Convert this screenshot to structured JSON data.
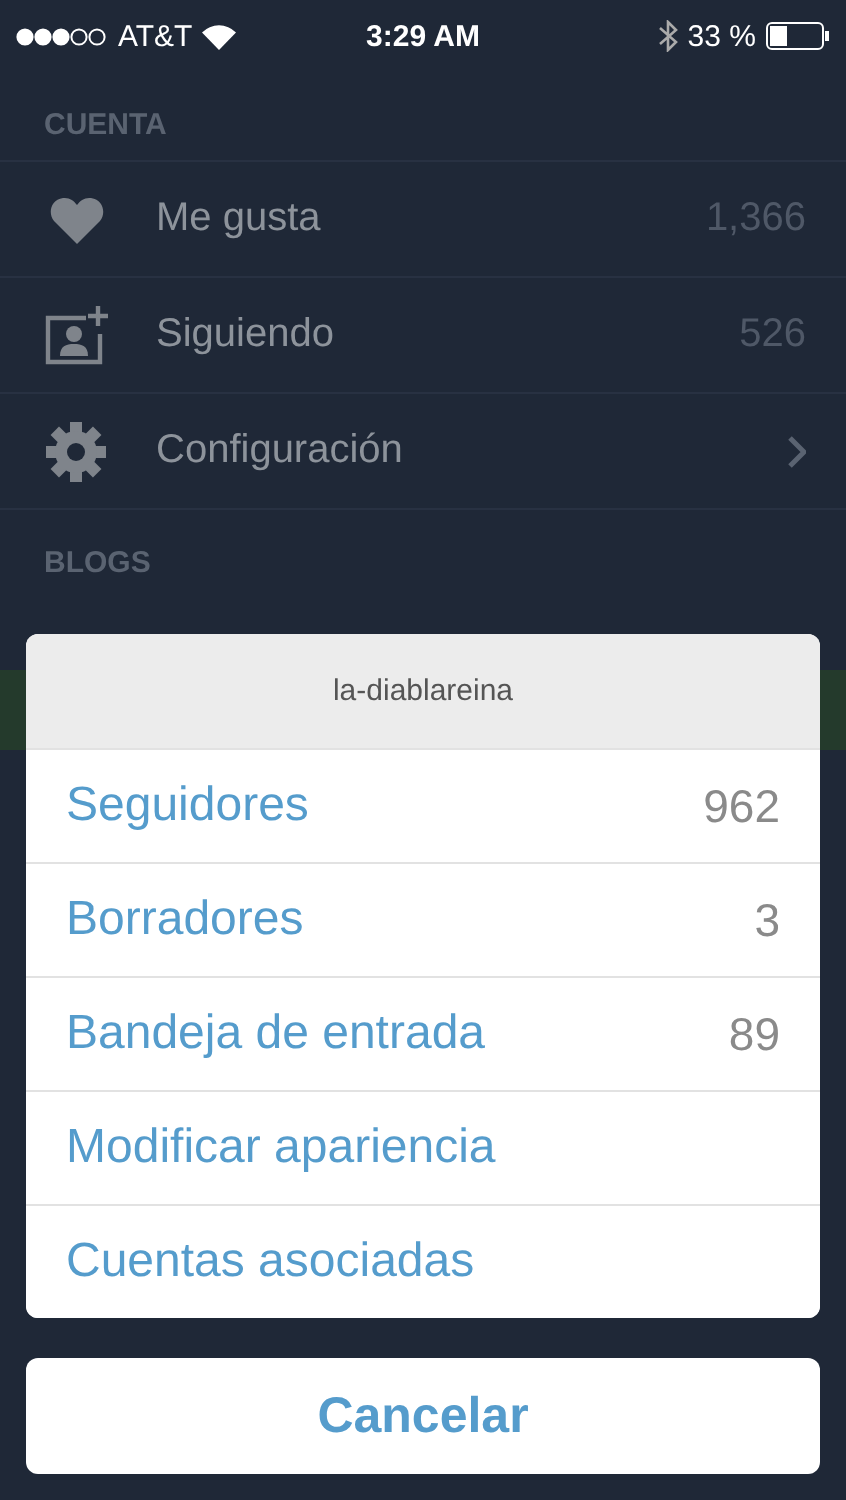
{
  "status_bar": {
    "carrier": "AT&T",
    "time": "3:29 AM",
    "battery": "33 %"
  },
  "account": {
    "heading": "CUENTA",
    "items": [
      {
        "kind": "likes",
        "label": "Me gusta",
        "count": "1,366"
      },
      {
        "kind": "following",
        "label": "Siguiendo",
        "count": "526"
      },
      {
        "kind": "settings",
        "label": "Configuración",
        "chevron": true
      }
    ]
  },
  "blogs": {
    "heading": "BLOGS"
  },
  "action_sheet": {
    "title": "la-diablareina",
    "items": [
      {
        "label": "Seguidores",
        "count": "962"
      },
      {
        "label": "Borradores",
        "count": "3"
      },
      {
        "label": "Bandeja de entrada",
        "count": "89"
      },
      {
        "label": "Modificar apariencia"
      },
      {
        "label": "Cuentas asociadas"
      }
    ],
    "cancel": "Cancelar"
  }
}
